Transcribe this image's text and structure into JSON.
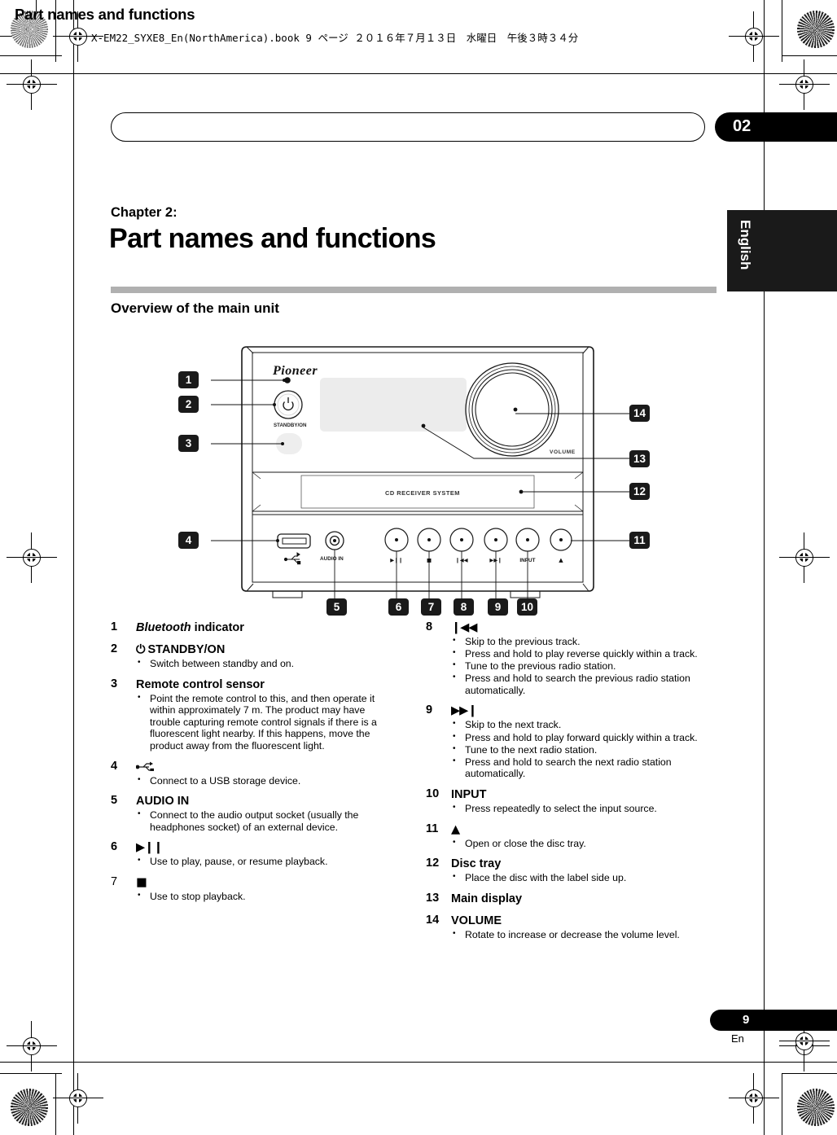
{
  "file_info": "X-EM22_SYXE8_En(NorthAmerica).book  9 ページ  ２０１６年７月１３日　水曜日　午後３時３４分",
  "header": {
    "running_title": "Part names and functions",
    "chapter_number": "02"
  },
  "side_tab": {
    "language": "English"
  },
  "chapter": {
    "label": "Chapter 2:",
    "heading": "Part names and functions"
  },
  "section": {
    "heading": "Overview of the main unit"
  },
  "figure": {
    "brand": "Pioneer",
    "standby_label": "STANDBY/ON",
    "audio_in_label": "AUDIO IN",
    "volume_label": "VOLUME",
    "disc_tray_label": "CD RECEIVER SYSTEM",
    "button_labels": {
      "play_pause": "▶❙❙",
      "stop": "■",
      "prev": "❙◀◀",
      "next": "▶▶❙",
      "input": "INPUT",
      "eject": "▲"
    },
    "callouts": [
      "1",
      "2",
      "3",
      "4",
      "5",
      "6",
      "7",
      "8",
      "9",
      "10",
      "11",
      "12",
      "13",
      "14"
    ]
  },
  "items_left": [
    {
      "num": "1",
      "title_italic": "Bluetooth",
      "title_rest": " indicator",
      "bullets": []
    },
    {
      "num": "2",
      "icon": "⏻",
      "title_rest": "STANDBY/ON",
      "bullets": [
        "Switch between standby and on."
      ]
    },
    {
      "num": "3",
      "title_rest": "Remote control sensor",
      "bullets": [
        "Point the remote control to this, and then operate it within approximately 7 m. The product may have trouble capturing remote control signals if there is a fluorescent light nearby. If this happens, move the product away from the fluorescent light."
      ]
    },
    {
      "num": "4",
      "icon": "usb-icon",
      "title_rest": "",
      "bullets": [
        "Connect to a USB storage device."
      ]
    },
    {
      "num": "5",
      "title_rest": "AUDIO IN",
      "bullets": [
        "Connect to the audio output socket (usually the headphones socket) of an external device."
      ]
    },
    {
      "num": "6",
      "title_rest": "▶❙❙",
      "bullets": [
        "Use to play, pause, or resume playback."
      ]
    },
    {
      "num": "7",
      "num_plain": true,
      "title_rest": "■",
      "bullets": [
        "Use to stop playback."
      ]
    }
  ],
  "items_right": [
    {
      "num": "8",
      "title_rest": "❙◀◀",
      "bullets": [
        "Skip to the previous track.",
        "Press and hold to play reverse quickly within a track.",
        "Tune to the previous radio station.",
        "Press and hold to search the previous radio station automatically."
      ]
    },
    {
      "num": "9",
      "title_rest": "▶▶❙",
      "bullets": [
        "Skip to the next track.",
        "Press and hold to play forward quickly within a track.",
        "Tune to the next radio station.",
        "Press and hold to search the next radio station automatically."
      ]
    },
    {
      "num": "10",
      "title_rest": "INPUT",
      "bullets": [
        "Press repeatedly to select the input source."
      ]
    },
    {
      "num": "11",
      "title_rest": "▲",
      "bullets": [
        "Open or close the disc tray."
      ]
    },
    {
      "num": "12",
      "title_rest": "Disc tray",
      "bullets": [
        "Place the disc with the label side up."
      ]
    },
    {
      "num": "13",
      "title_rest": "Main display",
      "bullets": []
    },
    {
      "num": "14",
      "title_rest": "VOLUME",
      "bullets": [
        "Rotate to increase or decrease the volume level."
      ]
    }
  ],
  "footer": {
    "page_number": "9",
    "page_language": "En"
  }
}
